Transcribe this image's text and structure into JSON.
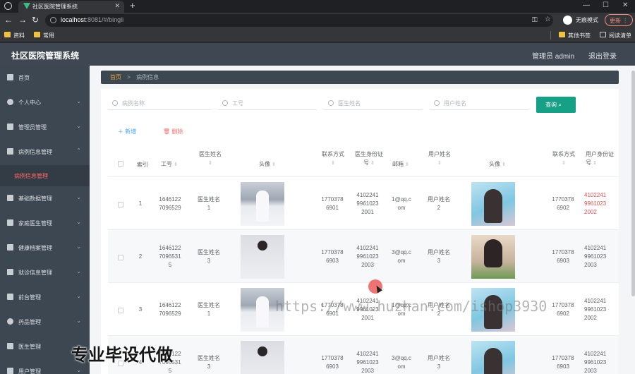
{
  "browser": {
    "tab_title": "社区医院管理系统",
    "url_host": "localhost",
    "url_path": ":8081/#/bingli",
    "incognito_label": "无痕模式",
    "update_label": "更新",
    "bookmarks": [
      "资料",
      "常用"
    ],
    "bookmarks_right": [
      "其他书签",
      "阅读清单"
    ]
  },
  "app": {
    "title": "社区医院管理系统",
    "admin_label": "管理员 admin",
    "logout_label": "退出登录"
  },
  "sidebar": {
    "items": [
      {
        "label": "首页"
      },
      {
        "label": "个人中心"
      },
      {
        "label": "管理员管理"
      },
      {
        "label": "病例信息管理"
      },
      {
        "label": "基础数据管理"
      },
      {
        "label": "家庭医生管理"
      },
      {
        "label": "健康档案管理"
      },
      {
        "label": "就诊信息管理"
      },
      {
        "label": "前台管理"
      },
      {
        "label": "药品管理"
      },
      {
        "label": "医生管理"
      },
      {
        "label": "用户管理"
      }
    ],
    "active_sub": "病例信息管理"
  },
  "breadcrumb": {
    "home": "首页",
    "separator": ">",
    "current": "病例信息"
  },
  "search": {
    "fields": [
      "病例名称",
      "工号",
      "医生姓名",
      "用户姓名"
    ],
    "query_label": "查询"
  },
  "actions": {
    "add": "新增",
    "delete": "删除"
  },
  "table": {
    "headers": [
      "索引",
      "工号",
      "医生姓名",
      "头像",
      "联系方式",
      "医生身份证号",
      "邮箱",
      "用户姓名",
      "头像",
      "联系方式",
      "用户身份证号"
    ],
    "rows": [
      {
        "index": "1",
        "gonghao": "1646122\n7096529",
        "doctor": "医生姓名\n1",
        "doc_phone": "1770378\n6901",
        "doc_id": "4102241\n9961023\n2001",
        "email": "1@qq.c\nom",
        "user": "用户姓名\n2",
        "user_phone": "1770378\n6902",
        "user_id": "4102241\n9961023\n2002"
      },
      {
        "index": "2",
        "gonghao": "1646122\n7096531\n5",
        "doctor": "医生姓名\n3",
        "doc_phone": "1770378\n6903",
        "doc_id": "4102241\n9961023\n2003",
        "email": "3@qq.c\nom",
        "user": "用户姓名\n3",
        "user_phone": "1770378\n6903",
        "user_id": "4102241\n9961023\n2003"
      },
      {
        "index": "3",
        "gonghao": "1646122\n7096529",
        "doctor": "医生姓名\n1",
        "doc_phone": "1770378\n6901",
        "doc_id": "4102241\n9961023\n2001",
        "email": "1@qq.c\nom",
        "user": "用户姓名\n2",
        "user_phone": "1770378\n6902",
        "user_id": "4102241\n9961023\n2002"
      },
      {
        "index": "4",
        "gonghao": "1646122\n7096531\n5",
        "doctor": "医生姓名\n3",
        "doc_phone": "1770378\n6903",
        "doc_id": "4102241\n9961023\n2003",
        "email": "3@qq.c\nom",
        "user": "用户姓名\n3",
        "user_phone": "1770378\n6903",
        "user_id": "4102241\n9961023\n2003"
      }
    ]
  },
  "watermark": {
    "url": "https://www.huzhan.com/ishop3930",
    "text": "专业毕设代做"
  }
}
